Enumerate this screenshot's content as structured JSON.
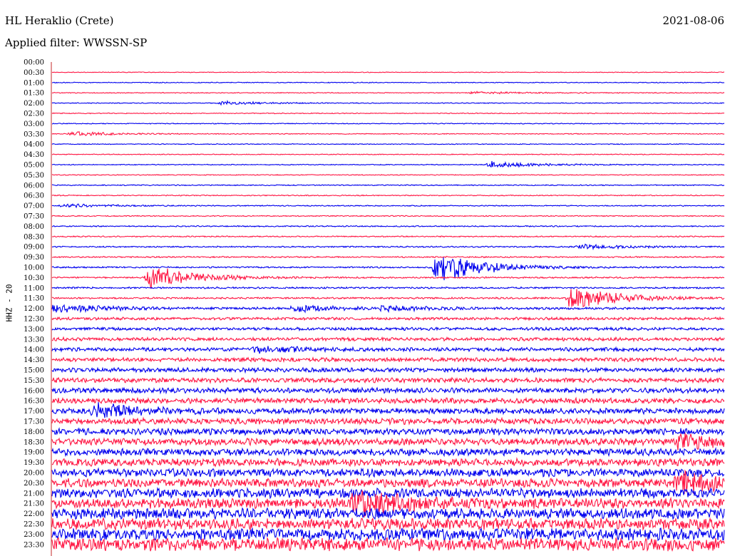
{
  "header": {
    "station": "HL Heraklio (Crete)",
    "date": "2021-08-06",
    "filter": "Applied filter: WWSSN-SP"
  },
  "chart_data": {
    "type": "line",
    "title": "HL Heraklio (Crete)",
    "subtitle": "Applied filter: WWSSN-SP",
    "ylabel": "HHZ - 20",
    "xlabel": "",
    "date": "2021-08-06",
    "y_tick_labels": [
      "00:00",
      "00:30",
      "01:00",
      "01:30",
      "02:00",
      "02:30",
      "03:00",
      "03:30",
      "04:00",
      "04:30",
      "05:00",
      "05:30",
      "06:00",
      "06:30",
      "07:00",
      "07:30",
      "08:00",
      "08:30",
      "09:00",
      "09:30",
      "10:00",
      "10:30",
      "11:00",
      "11:30",
      "12:00",
      "12:30",
      "13:00",
      "13:30",
      "14:00",
      "14:30",
      "15:00",
      "15:30",
      "16:00",
      "16:30",
      "17:00",
      "17:30",
      "18:00",
      "18:30",
      "19:00",
      "19:30",
      "20:00",
      "20:30",
      "21:00",
      "21:30",
      "22:00",
      "22:30",
      "23:00",
      "23:30"
    ],
    "x_range_minutes": [
      0,
      15
    ],
    "colors": {
      "odd": "#0000ee",
      "even": "#ff1744",
      "axis": "#c62828",
      "text": "#000000"
    },
    "trace_noise_level": [
      0,
      0.4,
      0.5,
      0.5,
      0.5,
      0.5,
      0.5,
      0.5,
      0.5,
      0.5,
      0.5,
      0.5,
      0.6,
      0.6,
      0.6,
      0.6,
      0.7,
      0.7,
      0.8,
      0.8,
      0.9,
      0.9,
      1.0,
      1.0,
      1.4,
      1.6,
      1.8,
      2.0,
      2.2,
      2.4,
      2.6,
      2.8,
      3.0,
      3.2,
      3.4,
      3.6,
      3.8,
      4.0,
      4.2,
      4.5,
      4.8,
      5.2,
      5.6,
      6.0,
      6.4,
      6.8,
      7.2,
      7.6
    ],
    "events": [
      {
        "time": "01:30",
        "minute": 9.4,
        "amplitude": 3
      },
      {
        "time": "02:00",
        "minute": 3.8,
        "amplitude": 4
      },
      {
        "time": "03:30",
        "minute": 0.5,
        "amplitude": 5
      },
      {
        "time": "05:00",
        "minute": 9.8,
        "amplitude": 8
      },
      {
        "time": "07:00",
        "minute": 0.3,
        "amplitude": 4
      },
      {
        "time": "09:00",
        "minute": 11.8,
        "amplitude": 6
      },
      {
        "time": "10:00",
        "minute": 8.6,
        "amplitude": 40
      },
      {
        "time": "10:30",
        "minute": 2.2,
        "amplitude": 30
      },
      {
        "time": "11:30",
        "minute": 11.6,
        "amplitude": 30
      },
      {
        "time": "12:00",
        "minute": 0.0,
        "amplitude": 12
      },
      {
        "time": "12:00",
        "minute": 5.4,
        "amplitude": 8
      },
      {
        "time": "12:00",
        "minute": 7.4,
        "amplitude": 6
      },
      {
        "time": "14:00",
        "minute": 4.6,
        "amplitude": 6
      },
      {
        "time": "17:00",
        "minute": 1.0,
        "amplitude": 15
      },
      {
        "time": "18:30",
        "minute": 14.0,
        "amplitude": 15
      },
      {
        "time": "20:30",
        "minute": 14.0,
        "amplitude": 25
      },
      {
        "time": "21:30",
        "minute": 6.8,
        "amplitude": 30
      }
    ]
  }
}
